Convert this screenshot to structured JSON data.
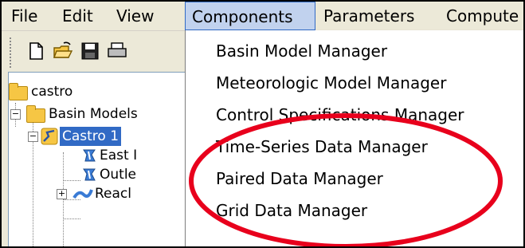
{
  "menubar": {
    "items": [
      {
        "label": "File"
      },
      {
        "label": "Edit"
      },
      {
        "label": "View"
      },
      {
        "label": "Components"
      },
      {
        "label": "Parameters"
      },
      {
        "label": "Compute"
      }
    ],
    "active_index": 3
  },
  "toolbar": {
    "icons": [
      "new-file-icon",
      "open-folder-icon",
      "save-icon",
      "print-icon"
    ]
  },
  "tree": {
    "root": "castro",
    "basin_models": "Basin Models",
    "model": "Castro 1",
    "child1": "East I",
    "child2": "Outle",
    "child3": "Reacl"
  },
  "dropdown": {
    "items": [
      "Basin Model Manager",
      "Meteorologic Model Manager",
      "Control Specifications Manager",
      "Time-Series Data Manager",
      "Paired Data Manager",
      "Grid Data Manager"
    ]
  },
  "annotation": {
    "color": "#e8001c"
  }
}
